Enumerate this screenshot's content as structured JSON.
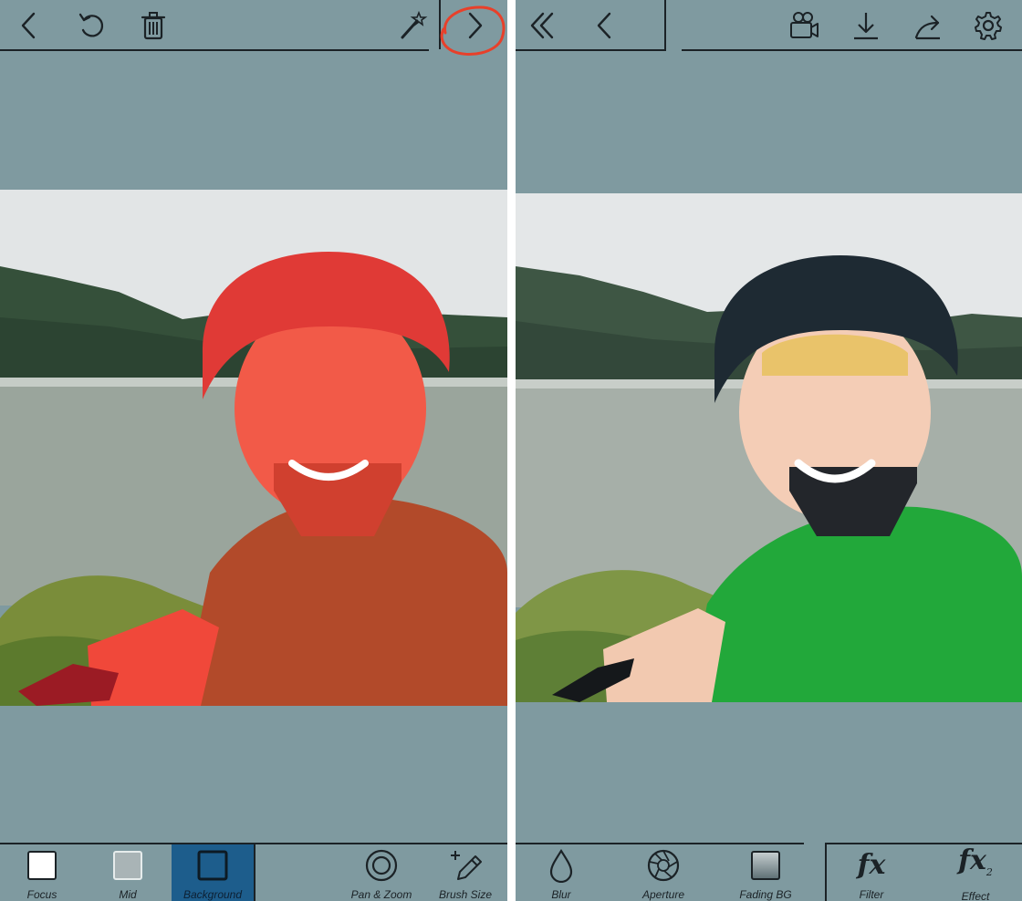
{
  "left": {
    "top_toolbar": {
      "back_icon": "chevron-left",
      "undo_icon": "undo-arrow",
      "delete_icon": "trash-can",
      "magic_icon": "magic-wand",
      "next_icon": "chevron-right",
      "next_highlight_color": "#e8402a"
    },
    "photo_tint": "#ff3b2f",
    "tools": [
      {
        "label": "Focus",
        "icon": "square-white"
      },
      {
        "label": "Mid",
        "icon": "square-grey"
      },
      {
        "label": "Background",
        "icon": "square-outline",
        "active": true
      },
      {
        "label": "Pan & Zoom",
        "icon": "target-circles"
      },
      {
        "label": "Brush Size",
        "icon": "pencil-plus-minus"
      }
    ]
  },
  "right": {
    "top_toolbar": {
      "first_icon": "double-chevron-left",
      "back_icon": "chevron-left",
      "video_icon": "video-camera",
      "download_icon": "download-arrow",
      "share_icon": "share-arrow",
      "settings_icon": "gear"
    },
    "tools": [
      {
        "label": "Blur",
        "icon": "drop"
      },
      {
        "label": "Aperture",
        "icon": "aperture"
      },
      {
        "label": "Fading BG",
        "icon": "gradient-square"
      },
      {
        "label": "Filter",
        "glyph": "fx"
      },
      {
        "label": "Effect",
        "glyph": "fx",
        "glyph_sub": "2"
      }
    ]
  },
  "colors": {
    "panel_bg": "#7f9aa0",
    "icon": "#1b2226",
    "active_tool": "#1d5d8c",
    "shirt_green": "#22a83a",
    "helmet_dark": "#1e2a33"
  }
}
